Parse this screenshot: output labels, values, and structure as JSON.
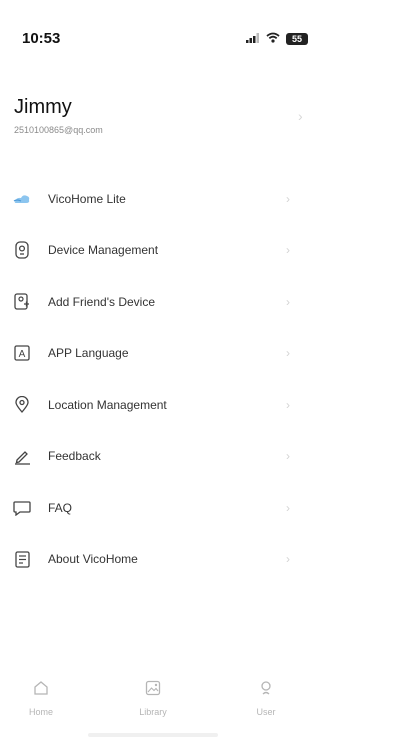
{
  "status_bar": {
    "time": "10:53",
    "battery": "55"
  },
  "profile": {
    "name": "Jimmy",
    "email": "2510100865@qq.com"
  },
  "menu": [
    {
      "label": "VicoHome Lite",
      "icon": "cloud-icon"
    },
    {
      "label": "Device Management",
      "icon": "camera-icon"
    },
    {
      "label": "Add Friend's Device",
      "icon": "share-device-icon"
    },
    {
      "label": "APP Language",
      "icon": "language-icon"
    },
    {
      "label": "Location Management",
      "icon": "location-pin-icon"
    },
    {
      "label": "Feedback",
      "icon": "pencil-icon"
    },
    {
      "label": "FAQ",
      "icon": "chat-bubble-icon"
    },
    {
      "label": "About VicoHome",
      "icon": "document-icon"
    }
  ],
  "tabs": [
    {
      "label": "Home",
      "icon": "home-icon"
    },
    {
      "label": "Library",
      "icon": "library-icon"
    },
    {
      "label": "User",
      "icon": "user-icon"
    }
  ],
  "colors": {
    "accent": "#5aa9e6",
    "text": "#333333",
    "muted": "#b5b5b5"
  }
}
